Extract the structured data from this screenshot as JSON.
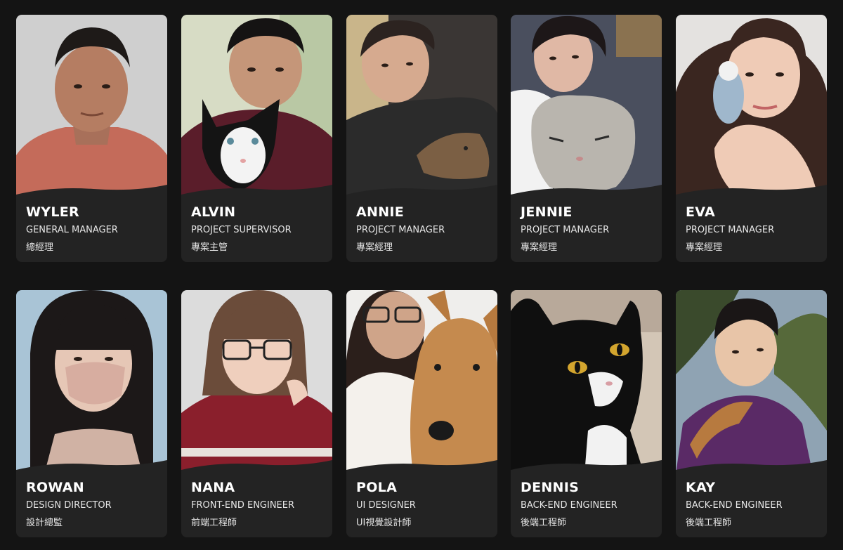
{
  "colors": {
    "page_background": "#141414",
    "card_background": "#232323",
    "name_text": "#ffffff",
    "title_text": "#e6e6e6"
  },
  "members": [
    {
      "name": "WYLER",
      "title_en": "GENERAL MANAGER",
      "title_zh": "總經理",
      "photo": "portrait-man-icon"
    },
    {
      "name": "ALVIN",
      "title_en": "PROJECT SUPERVISOR",
      "title_zh": "專案主管",
      "photo": "portrait-with-cat-icon"
    },
    {
      "name": "ANNIE",
      "title_en": "PROJECT MANAGER",
      "title_zh": "專案經理",
      "photo": "portrait-with-cat-icon"
    },
    {
      "name": "JENNIE",
      "title_en": "PROJECT MANAGER",
      "title_zh": "專案經理",
      "photo": "portrait-with-cat-icon"
    },
    {
      "name": "EVA",
      "title_en": "PROJECT MANAGER",
      "title_zh": "專案經理",
      "photo": "portrait-with-bird-icon"
    },
    {
      "name": "ROWAN",
      "title_en": "DESIGN DIRECTOR",
      "title_zh": "設計總監",
      "photo": "portrait-woman-mask-icon"
    },
    {
      "name": "NANA",
      "title_en": "FRONT-END ENGINEER",
      "title_zh": "前端工程師",
      "photo": "portrait-woman-glasses-icon"
    },
    {
      "name": "POLA",
      "title_en": "UI DESIGNER",
      "title_zh": "UI視覺設計師",
      "photo": "portrait-with-dog-icon"
    },
    {
      "name": "DENNIS",
      "title_en": "BACK-END ENGINEER",
      "title_zh": "後端工程師",
      "photo": "cat-portrait-icon"
    },
    {
      "name": "KAY",
      "title_en": "BACK-END ENGINEER",
      "title_zh": "後端工程師",
      "photo": "portrait-man-outdoor-icon"
    }
  ]
}
